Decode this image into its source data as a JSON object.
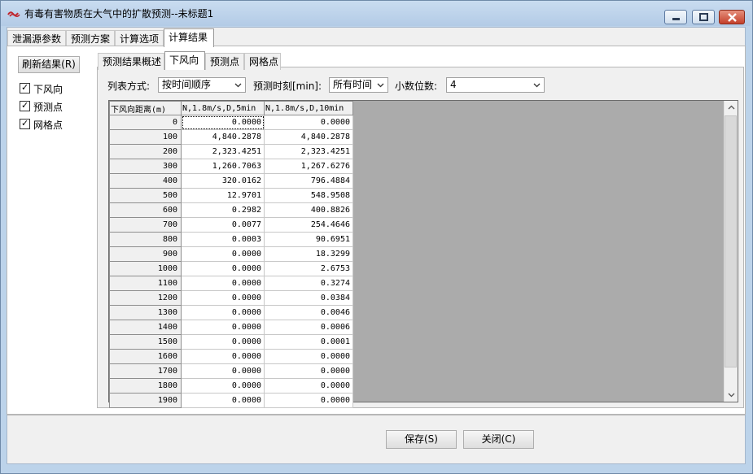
{
  "window": {
    "title": "有毒有害物质在大气中的扩散预测--未标题1",
    "controls": {
      "minimize": "minimize-icon",
      "maximize": "maximize-icon",
      "close": "close-icon"
    }
  },
  "top_tabs": [
    "泄漏源参数",
    "预测方案",
    "计算选项",
    "计算结果"
  ],
  "top_tab_active": "计算结果",
  "left_panel": {
    "refresh_button": "刷新结果(R)",
    "checkboxes": [
      {
        "label": "下风向",
        "checked": true
      },
      {
        "label": "预测点",
        "checked": true
      },
      {
        "label": "网格点",
        "checked": true
      }
    ]
  },
  "sub_tabs": [
    "预测结果概述",
    "下风向",
    "预测点",
    "网格点"
  ],
  "sub_tab_active": "下风向",
  "options": {
    "list_mode_label": "列表方式:",
    "list_mode_value": "按时间顺序",
    "time_label": "预测时刻[min]:",
    "time_value": "所有时间",
    "decimals_label": "小数位数:",
    "decimals_value": "4"
  },
  "table": {
    "headers": [
      "下风向距离(m)",
      "N,1.8m/s,D,5min",
      "N,1.8m/s,D,10min"
    ],
    "rows": [
      [
        "0",
        "0.0000",
        "0.0000"
      ],
      [
        "100",
        "4,840.2878",
        "4,840.2878"
      ],
      [
        "200",
        "2,323.4251",
        "2,323.4251"
      ],
      [
        "300",
        "1,260.7063",
        "1,267.6276"
      ],
      [
        "400",
        "320.0162",
        "796.4884"
      ],
      [
        "500",
        "12.9701",
        "548.9508"
      ],
      [
        "600",
        "0.2982",
        "400.8826"
      ],
      [
        "700",
        "0.0077",
        "254.4646"
      ],
      [
        "800",
        "0.0003",
        "90.6951"
      ],
      [
        "900",
        "0.0000",
        "18.3299"
      ],
      [
        "1000",
        "0.0000",
        "2.6753"
      ],
      [
        "1100",
        "0.0000",
        "0.3274"
      ],
      [
        "1200",
        "0.0000",
        "0.0384"
      ],
      [
        "1300",
        "0.0000",
        "0.0046"
      ],
      [
        "1400",
        "0.0000",
        "0.0006"
      ],
      [
        "1500",
        "0.0000",
        "0.0001"
      ],
      [
        "1600",
        "0.0000",
        "0.0000"
      ],
      [
        "1700",
        "0.0000",
        "0.0000"
      ],
      [
        "1800",
        "0.0000",
        "0.0000"
      ],
      [
        "1900",
        "0.0000",
        "0.0000"
      ]
    ]
  },
  "buttons": {
    "save": "保存(S)",
    "close": "关闭(C)"
  }
}
